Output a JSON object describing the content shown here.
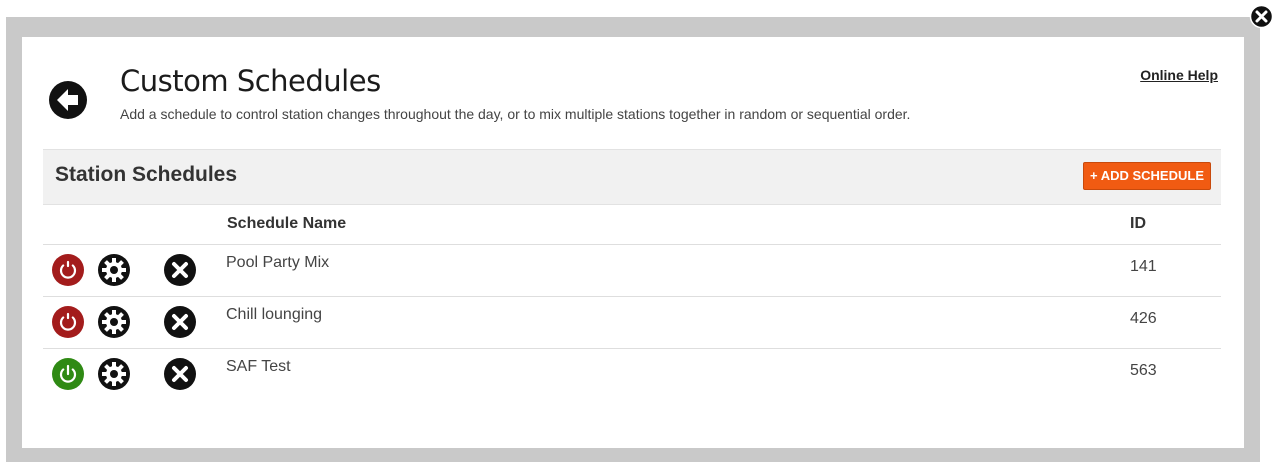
{
  "dialog": {
    "title": "Custom Schedules",
    "subtitle": "Add a schedule to control station changes throughout the day, or to mix multiple stations together in random or sequential order.",
    "help_link": "Online Help",
    "back_icon": "arrow-left-circle-icon",
    "close_icon": "close-circle-icon"
  },
  "section": {
    "title": "Station Schedules",
    "add_button": "+ ADD SCHEDULE"
  },
  "table": {
    "columns": {
      "name": "Schedule Name",
      "id": "ID"
    },
    "rows": [
      {
        "name": "Pool Party Mix",
        "id": "141",
        "status": "off",
        "status_color": "#a31c1c"
      },
      {
        "name": "Chill lounging",
        "id": "426",
        "status": "off",
        "status_color": "#a31c1c"
      },
      {
        "name": "SAF Test",
        "id": "563",
        "status": "on",
        "status_color": "#2f8a14"
      }
    ]
  },
  "colors": {
    "accent_button": "#f15b12",
    "power_off": "#a31c1c",
    "power_on": "#2f8a14",
    "frame": "#c9c9c9",
    "section_bar": "#f1f1f1"
  }
}
